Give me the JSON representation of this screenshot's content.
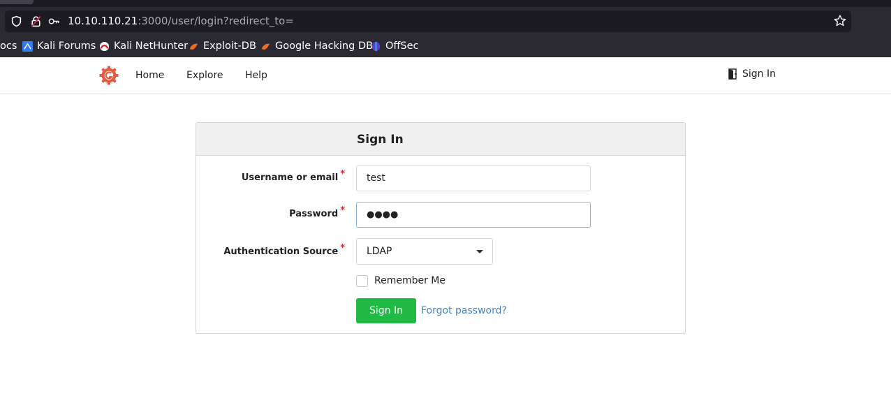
{
  "browser": {
    "url_host": "10.10.110.21",
    "url_rest": ":3000/user/login?redirect_to=",
    "bookmarks": [
      {
        "label": "ocs",
        "icon": "docs-icon"
      },
      {
        "label": "Kali Forums",
        "icon": "kali-forums-icon"
      },
      {
        "label": "Kali NetHunter",
        "icon": "kali-nethunter-icon"
      },
      {
        "label": "Exploit-DB",
        "icon": "exploit-db-icon"
      },
      {
        "label": "Google Hacking DB",
        "icon": "ghdb-icon"
      },
      {
        "label": "OffSec",
        "icon": "offsec-icon"
      }
    ]
  },
  "nav": {
    "items": [
      "Home",
      "Explore",
      "Help"
    ],
    "sign_in": "Sign In",
    "logo_color": "#e05d44"
  },
  "form": {
    "title": "Sign In",
    "username_label": "Username or email",
    "username_value": "test",
    "password_label": "Password",
    "password_value": "●●●●",
    "auth_source_label": "Authentication Source",
    "auth_source_value": "LDAP",
    "remember_label": "Remember Me",
    "remember_checked": false,
    "submit_label": "Sign In",
    "forgot_label": "Forgot password?",
    "required_mark": "*"
  },
  "colors": {
    "primary_button": "#21ba45",
    "link": "#4183c4",
    "required": "#db2828"
  }
}
